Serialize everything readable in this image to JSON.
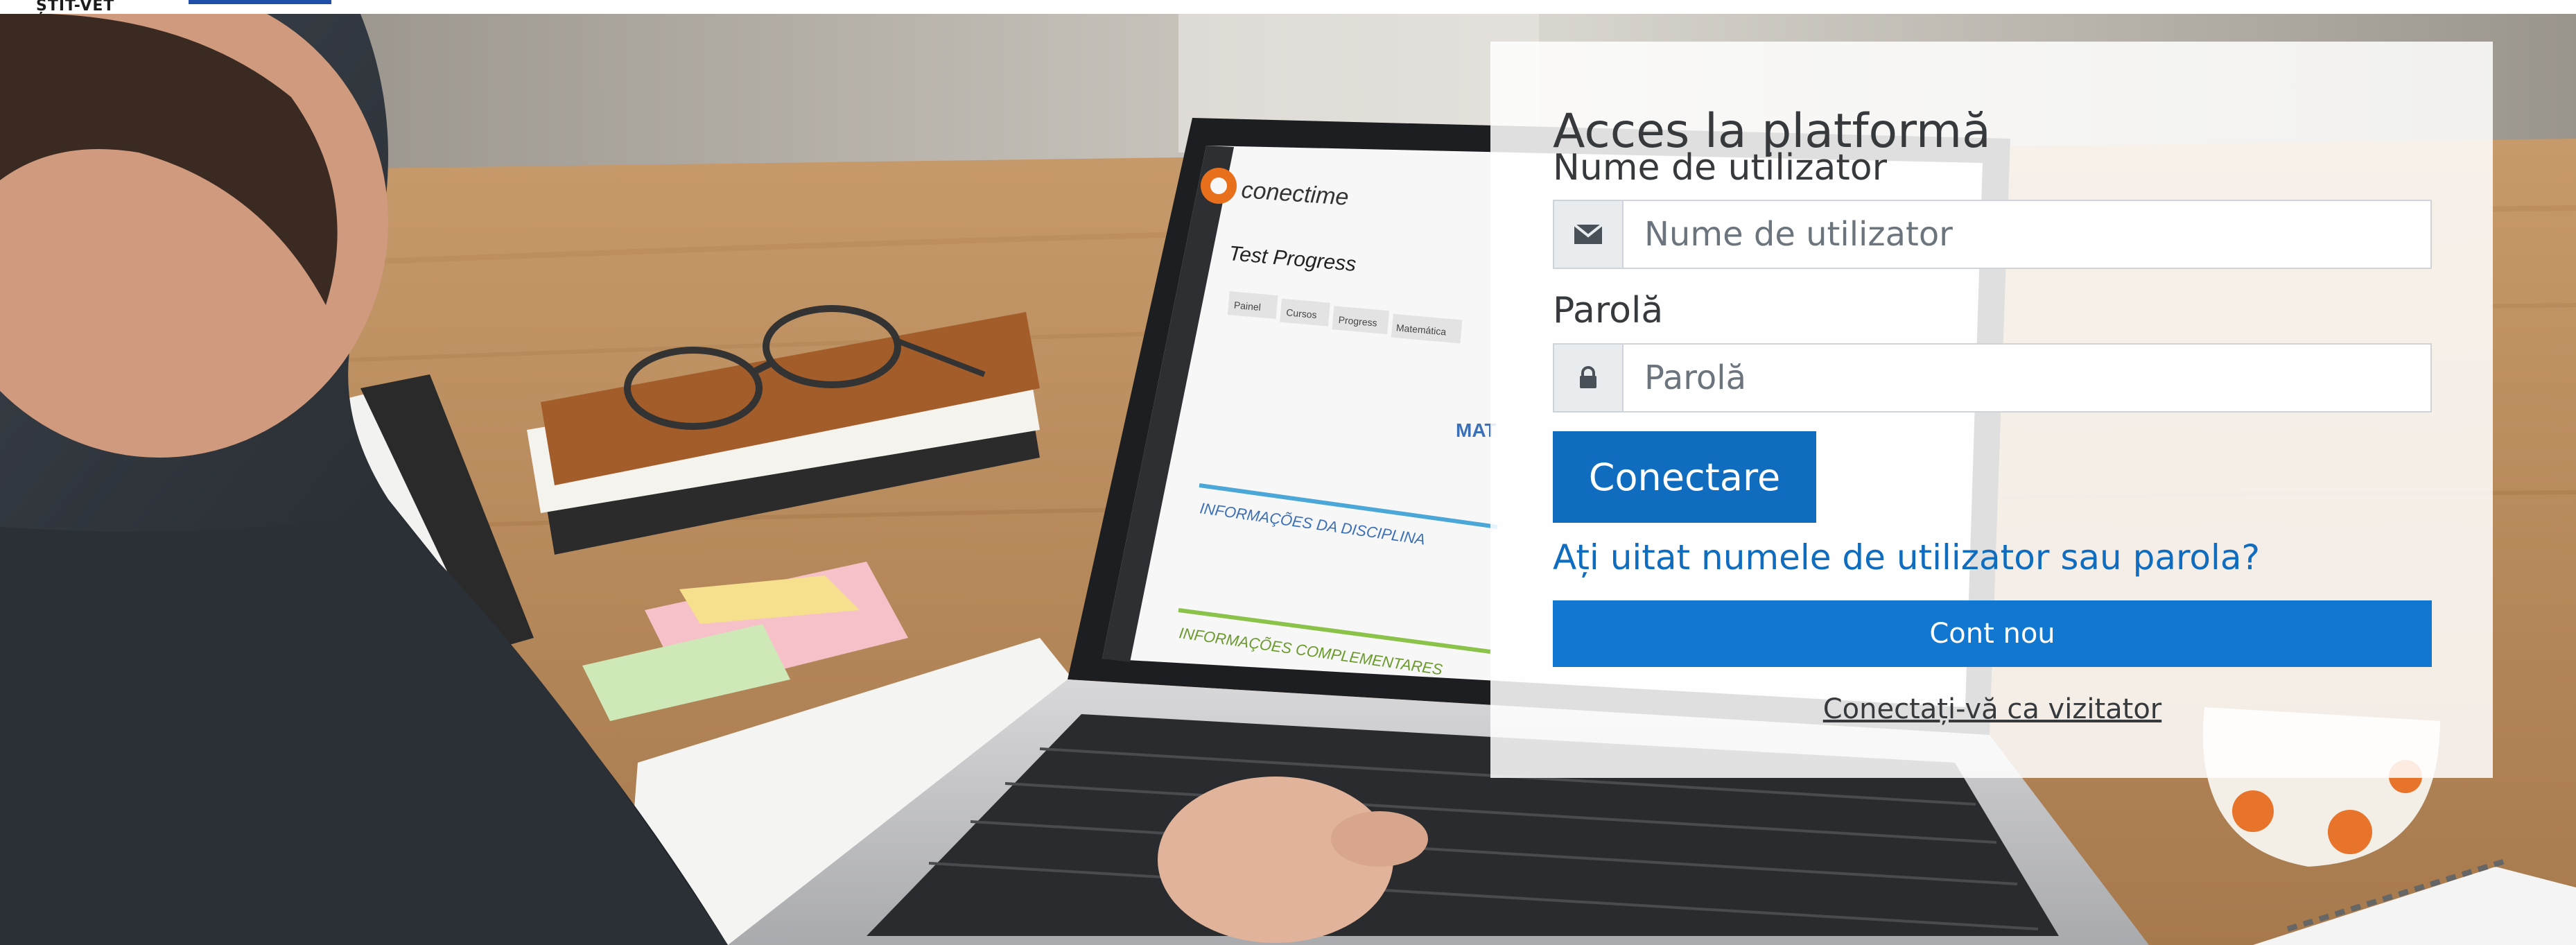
{
  "header": {
    "logo_text": "ȘTIT-VET"
  },
  "login": {
    "title": "Acces la platformă",
    "username_label": "Nume de utilizator",
    "username_placeholder": "Nume de utilizator",
    "username_icon": "envelope-icon",
    "password_label": "Parolă",
    "password_placeholder": "Parolă",
    "password_icon": "lock-icon",
    "submit_label": "Conectare",
    "forgot_link": "Ați uitat numele de utilizator sau parola?",
    "new_account_label": "Cont nou",
    "guest_link": "Conectați-vă ca vizitator"
  },
  "background": {
    "laptop_screen": {
      "brand": "conectime",
      "course_title": "Test Progress",
      "tabs": [
        "Painel",
        "Cursos",
        "Progress",
        "Matemática"
      ],
      "section_1": "INFORMAÇÕES DA DISCIPLINA",
      "section_2": "INFORMAÇÕES COMPLEMENTARES",
      "heading_fragment": "MAT"
    }
  },
  "colors": {
    "primary": "#0f6cbf",
    "new_account": "#1177d1",
    "text": "#373a3c",
    "card_bg": "#ffffff"
  }
}
